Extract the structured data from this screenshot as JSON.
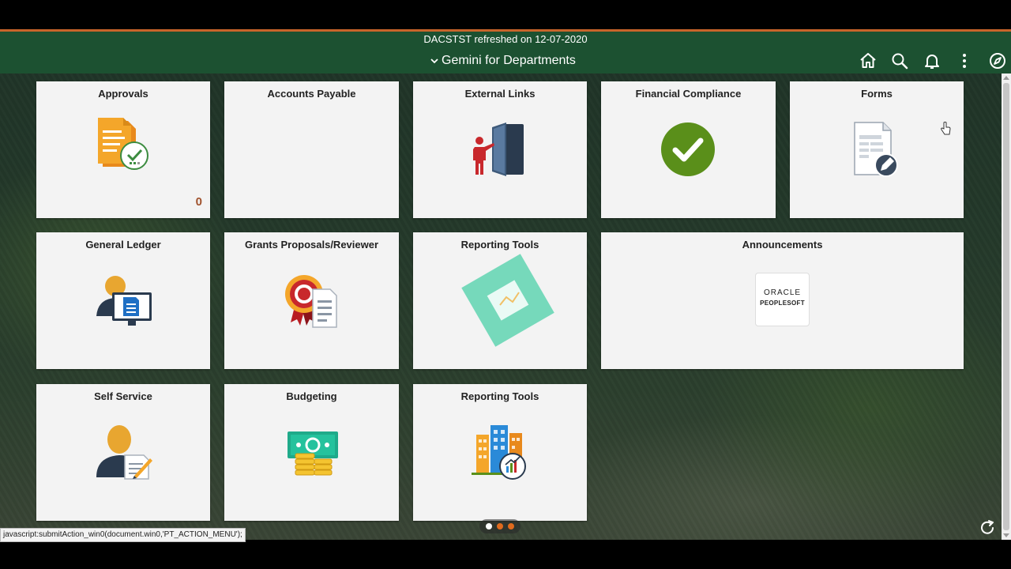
{
  "header": {
    "refresh_message": "DACSTST refreshed on 12-07-2020",
    "homepage_title": "Gemini for Departments",
    "icons": [
      "home-icon",
      "search-icon",
      "bell-icon",
      "more-vertical-icon",
      "navbar-compass-icon"
    ]
  },
  "tiles": {
    "approvals": {
      "title": "Approvals",
      "badge": "0"
    },
    "accounts_payable": {
      "title": "Accounts Payable"
    },
    "external_links": {
      "title": "External Links"
    },
    "financial_compliance": {
      "title": "Financial Compliance"
    },
    "forms": {
      "title": "Forms"
    },
    "general_ledger": {
      "title": "General Ledger"
    },
    "grants": {
      "title": "Grants Proposals/Reviewer"
    },
    "reporting_tools_1": {
      "title": "Reporting Tools"
    },
    "announcements": {
      "title": "Announcements",
      "logo_line1": "ORACLE",
      "logo_line2": "PEOPLESOFT"
    },
    "self_service": {
      "title": "Self Service"
    },
    "budgeting": {
      "title": "Budgeting"
    },
    "reporting_tools_2": {
      "title": "Reporting Tools"
    }
  },
  "pager": {
    "pages": 3,
    "active_index": 0
  },
  "status_bar": {
    "text": "javascript:submitAction_win0(document.win0,'PT_ACTION_MENU');"
  },
  "colors": {
    "header_bg": "#1c5131",
    "header_accent": "#c8642a",
    "tile_bg": "#f3f3f3",
    "pager_dot": "#e06a1e",
    "compliance_green": "#5a8f1a"
  }
}
